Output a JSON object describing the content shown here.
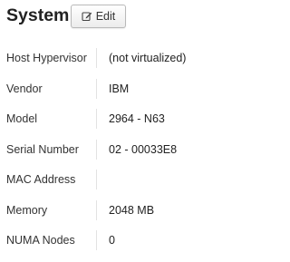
{
  "header": {
    "title": "System",
    "edit_label": "Edit"
  },
  "properties": [
    {
      "label": "Host Hypervisor",
      "value": "(not virtualized)"
    },
    {
      "label": "Vendor",
      "value": "IBM"
    },
    {
      "label": "Model",
      "value": "2964 - N63"
    },
    {
      "label": "Serial Number",
      "value": "02 - 00033E8"
    },
    {
      "label": "MAC Address",
      "value": ""
    },
    {
      "label": "Memory",
      "value": "2048 MB"
    },
    {
      "label": "NUMA Nodes",
      "value": "0"
    }
  ]
}
